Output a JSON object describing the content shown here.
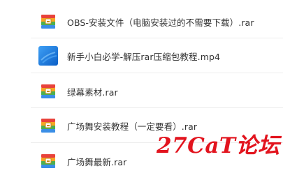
{
  "files": [
    {
      "name": "OBS-安装文件（电脑安装过的不需要下载）.rar",
      "icon": "archive-icon"
    },
    {
      "name": "新手小白必学-解压rar压缩包教程.mp4",
      "icon": "video-icon"
    },
    {
      "name": "绿幕素材.rar",
      "icon": "archive-icon"
    },
    {
      "name": "广场舞安装教程（一定要看）.rar",
      "icon": "archive-icon"
    },
    {
      "name": "广场舞最新.rar",
      "icon": "archive-icon"
    }
  ],
  "watermark": "27CaT论坛",
  "colors": {
    "watermark": "#e2141e",
    "text": "#333333",
    "archive_red": "#e8423b",
    "archive_orange": "#f6a623",
    "archive_green": "#4caf50",
    "archive_blue": "#3a8ee6",
    "video_blue": "#1f7be0"
  }
}
